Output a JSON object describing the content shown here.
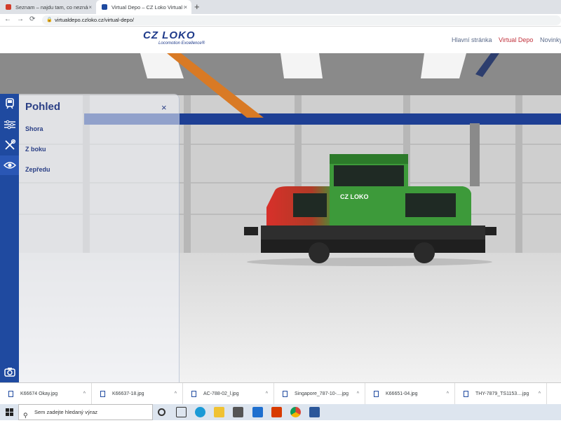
{
  "browser": {
    "tabs": [
      {
        "title": "Seznam – najdu tam, co neznám",
        "favicon_color": "#d23c2b"
      },
      {
        "title": "Virtual Depo – CZ Loko Virtual D",
        "favicon_color": "#1f4aa0"
      }
    ],
    "new_tab_symbol": "+",
    "close_symbol": "×",
    "url": "virtualdepo.czloko.cz/virtual-depo/",
    "nav": {
      "back": "←",
      "forward": "→",
      "reload": "⟳"
    }
  },
  "site": {
    "logo_text": "CZ LOKO",
    "logo_tagline": "Locomotion Excellence®",
    "nav": [
      "Hlavní stránka",
      "Virtual Depo",
      "Novinky"
    ],
    "active_nav": "Virtual Depo"
  },
  "toolbar": {
    "icons": [
      "locomotive-icon",
      "sliders-icon",
      "tools-icon",
      "eye-icon",
      "camera-icon"
    ]
  },
  "panel": {
    "title": "Pohled",
    "close_symbol": "×",
    "items": [
      "Shora",
      "Z boku",
      "Zepředu"
    ]
  },
  "viewport": {
    "locomotive_label": "CZ LOKO",
    "colors": {
      "body_green": "#3d9a3a",
      "body_red": "#d8302a",
      "cab_dark": "#1f2a24",
      "beam_blue": "#1e3f94",
      "crane_orange": "#d97a25"
    }
  },
  "downloads": [
    {
      "name": "K66674 Okay.jpg"
    },
    {
      "name": "K66637-18.jpg"
    },
    {
      "name": "AC-788-02_l.jpg"
    },
    {
      "name": "Singapore_787-10-....jpg"
    },
    {
      "name": "K66651-04.jpg"
    },
    {
      "name": "THY-7879_TS1153....jpg"
    }
  ],
  "taskbar": {
    "search_placeholder": "Sem zadejte hledaný výraz"
  },
  "accent": "#1f4aa0"
}
